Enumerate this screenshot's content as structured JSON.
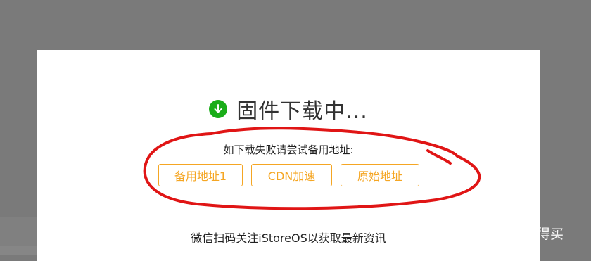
{
  "dialog": {
    "title": "固件下载中...",
    "hint": "如下载失败请尝试备用地址:",
    "buttons": [
      {
        "label": "备用地址1"
      },
      {
        "label": "CDN加速"
      },
      {
        "label": "原始地址"
      }
    ],
    "follow_text": "微信扫码关注iStoreOS以获取最新资讯"
  },
  "watermark": {
    "text": "什么值得买"
  },
  "colors": {
    "accent": "#f5a623",
    "success": "#1aad19",
    "annotation": "#e01515"
  }
}
